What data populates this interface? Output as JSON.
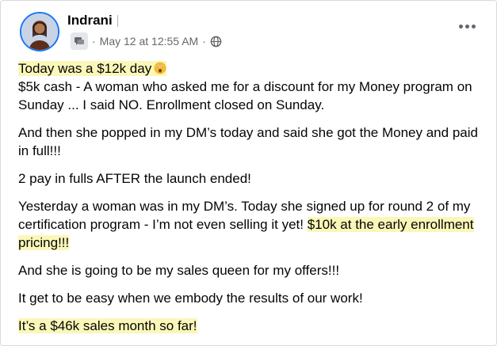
{
  "post": {
    "author": "Indrani",
    "timestamp": "May 12 at 12:55 AM",
    "separator": "·",
    "icons": {
      "group": "group-chat-icon",
      "audience": "globe-icon",
      "menu": "more-options-icon",
      "emoji": "shocked-face-emoji"
    },
    "colors": {
      "highlight": "#faf7b8",
      "text": "#050505",
      "meta": "#65676b"
    },
    "paragraphs": {
      "p1_highlight": "Today was a $12k day",
      "p1_line2": "$5k cash - A woman who asked me for a discount for my Money program on Sunday ... I said NO. Enrollment closed on Sunday.",
      "p2": "And then she popped in my DM’s today and said she got the Money and paid in full!!!",
      "p3": "2 pay in fulls AFTER the launch ended!",
      "p4_text": "Yesterday a woman was in my DM’s. Today she signed up for round 2 of my certification program - I’m not even selling it yet! ",
      "p4_highlight": "$10k at the early enrollment pricing!!!",
      "p5": "And she is going to be my sales queen for my offers!!!",
      "p6": "It get to be easy when we embody the results of our work!",
      "p7_highlight": "It’s a $46k sales month so far!"
    }
  }
}
